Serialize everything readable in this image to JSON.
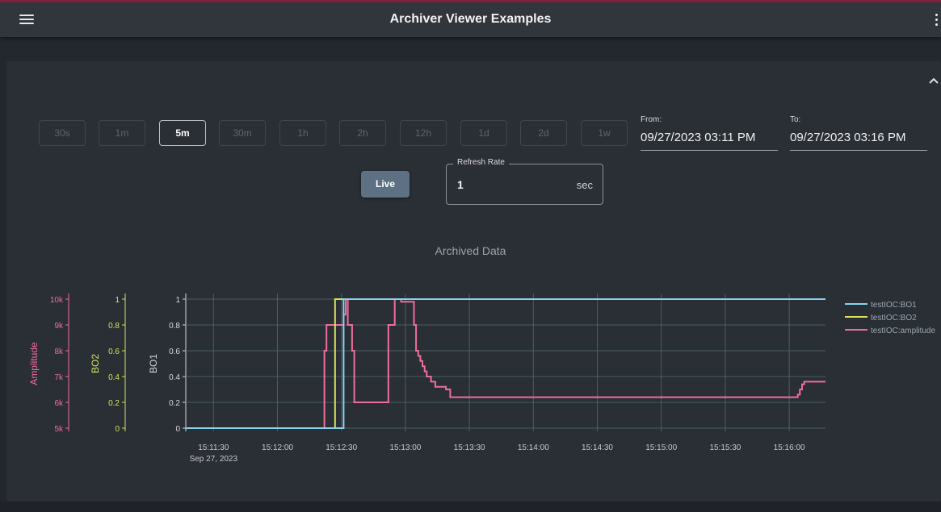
{
  "app": {
    "title": "Archiver Viewer Examples"
  },
  "icons": {
    "menu": "hamburger-menu-icon",
    "more": "more-vertical-icon",
    "collapse": "chevron-up-icon"
  },
  "time_ranges": {
    "selected": "5m",
    "options": [
      "30s",
      "1m",
      "5m",
      "30m",
      "1h",
      "2h",
      "12h",
      "1d",
      "2d",
      "1w"
    ]
  },
  "from": {
    "label": "From:",
    "value": "09/27/2023 03:11 PM"
  },
  "to": {
    "label": "To:",
    "value": "09/27/2023 03:16 PM"
  },
  "live_button": {
    "label": "Live"
  },
  "refresh_rate": {
    "label": "Refresh Rate",
    "value": "1",
    "unit": "sec"
  },
  "colors": {
    "BO1": "#8ad3ef",
    "BO2": "#d6e35d",
    "amplitude": "#ef6f9c",
    "grid": "#4a5e66",
    "axis": "#c8c8c8",
    "active_button_border": "#b9c3cc",
    "live_button_bg": "#5e7184"
  },
  "chart_data": {
    "type": "line",
    "title": "Archived Data",
    "x_unit": "time",
    "x_ticks": [
      "15:11:30",
      "15:12:00",
      "15:12:30",
      "15:13:00",
      "15:13:30",
      "15:14:00",
      "15:14:30",
      "15:15:00",
      "15:15:30",
      "15:16:00"
    ],
    "x_date_label": "Sep 27, 2023",
    "xlim": [
      "15:11:17",
      "15:16:17"
    ],
    "grid": true,
    "legend_position": "right",
    "y_axes": [
      {
        "id": "BO1",
        "label": "BO1",
        "ylim": [
          0,
          1
        ],
        "ticks": [
          "0",
          "0.2",
          "0.4",
          "0.6",
          "0.8",
          "1"
        ],
        "color": "#d8d8d8"
      },
      {
        "id": "BO2",
        "label": "BO2",
        "ylim": [
          0,
          1
        ],
        "ticks": [
          "0",
          "0.2",
          "0.4",
          "0.6",
          "0.8",
          "1"
        ],
        "color": "#d6e35d"
      },
      {
        "id": "Amplitude",
        "label": "Amplitude",
        "ylim": [
          5000,
          10000
        ],
        "ticks": [
          "5k",
          "6k",
          "7k",
          "8k",
          "9k",
          "10k"
        ],
        "color": "#ef6f9c"
      }
    ],
    "series": [
      {
        "name": "testIOC:BO1",
        "axis": "BO1",
        "step": true,
        "color": "#8ad3ef",
        "points": [
          [
            "15:11:17",
            0
          ],
          [
            "15:12:31",
            0
          ],
          [
            "15:12:31",
            1
          ],
          [
            "15:16:17",
            1
          ]
        ]
      },
      {
        "name": "testIOC:BO2",
        "axis": "BO2",
        "step": true,
        "color": "#d6e35d",
        "points": [
          [
            "15:11:17",
            0
          ],
          [
            "15:12:27",
            0
          ],
          [
            "15:12:27",
            1
          ],
          [
            "15:16:17",
            1
          ]
        ]
      },
      {
        "name": "testIOC:amplitude",
        "axis": "Amplitude",
        "step": true,
        "color": "#ef6f9c",
        "points": [
          [
            "15:11:17",
            5000
          ],
          [
            "15:12:22",
            5000
          ],
          [
            "15:12:22",
            8000
          ],
          [
            "15:12:23",
            8000
          ],
          [
            "15:12:23",
            9000
          ],
          [
            "15:12:31",
            9000
          ],
          [
            "15:12:31",
            9400
          ],
          [
            "15:12:32",
            9400
          ],
          [
            "15:12:32",
            10000
          ],
          [
            "15:12:33",
            10000
          ],
          [
            "15:12:33",
            9000
          ],
          [
            "15:12:35",
            9000
          ],
          [
            "15:12:35",
            8000
          ],
          [
            "15:12:36",
            8000
          ],
          [
            "15:12:36",
            6000
          ],
          [
            "15:12:52",
            6000
          ],
          [
            "15:12:52",
            9000
          ],
          [
            "15:12:55",
            9000
          ],
          [
            "15:12:55",
            10000
          ],
          [
            "15:12:58",
            10000
          ],
          [
            "15:12:58",
            9900
          ],
          [
            "15:13:04",
            9900
          ],
          [
            "15:13:04",
            9000
          ],
          [
            "15:13:05",
            9000
          ],
          [
            "15:13:05",
            8000
          ],
          [
            "15:13:06",
            8000
          ],
          [
            "15:13:06",
            7800
          ],
          [
            "15:13:07",
            7800
          ],
          [
            "15:13:07",
            7600
          ],
          [
            "15:13:08",
            7600
          ],
          [
            "15:13:08",
            7400
          ],
          [
            "15:13:09",
            7400
          ],
          [
            "15:13:09",
            7200
          ],
          [
            "15:13:10",
            7200
          ],
          [
            "15:13:10",
            7000
          ],
          [
            "15:13:12",
            7000
          ],
          [
            "15:13:12",
            6800
          ],
          [
            "15:13:14",
            6800
          ],
          [
            "15:13:14",
            6600
          ],
          [
            "15:13:19",
            6600
          ],
          [
            "15:13:19",
            6500
          ],
          [
            "15:13:21",
            6500
          ],
          [
            "15:13:21",
            6200
          ],
          [
            "15:16:04",
            6200
          ],
          [
            "15:16:04",
            6300
          ],
          [
            "15:16:05",
            6300
          ],
          [
            "15:16:05",
            6500
          ],
          [
            "15:16:06",
            6500
          ],
          [
            "15:16:06",
            6700
          ],
          [
            "15:16:07",
            6700
          ],
          [
            "15:16:07",
            6800
          ],
          [
            "15:16:17",
            6800
          ]
        ]
      }
    ]
  }
}
